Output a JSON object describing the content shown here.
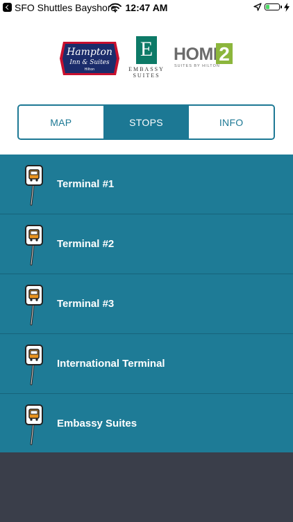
{
  "status_bar": {
    "back_app": "SFO Shuttles Bayshore",
    "time": "12:47 AM",
    "battery_fraction": 0.25
  },
  "logos": {
    "hampton": {
      "line1": "Hampton",
      "line2": "Inn & Suites",
      "line3": "Hilton"
    },
    "embassy": {
      "mark": "E",
      "line1": "EMBASSY",
      "line2": "SUITES"
    },
    "home2": {
      "word": "HOME",
      "numeral": "2",
      "sub": "SUITES BY HILTON"
    }
  },
  "tabs": [
    {
      "label": "MAP",
      "active": false
    },
    {
      "label": "STOPS",
      "active": true
    },
    {
      "label": "INFO",
      "active": false
    }
  ],
  "stops": [
    {
      "label": "Terminal #1"
    },
    {
      "label": "Terminal #2"
    },
    {
      "label": "Terminal #3"
    },
    {
      "label": "International Terminal"
    },
    {
      "label": "Embassy Suites"
    }
  ],
  "colors": {
    "accent": "#1c7894",
    "row_bg": "#1e7b96",
    "footer_bg": "#3a3e4a",
    "hampton_navy": "#1b2c6b",
    "hampton_red": "#c8102e",
    "embassy_green": "#0d7a67",
    "home2_green": "#8cb63c",
    "stop_sign_orange": "#e8921e"
  },
  "icons": {
    "status": [
      "back-icon",
      "wifi-icon",
      "location-arrow-icon",
      "battery-icon",
      "charging-bolt-icon"
    ],
    "stop": "bus-stop-sign-icon"
  }
}
